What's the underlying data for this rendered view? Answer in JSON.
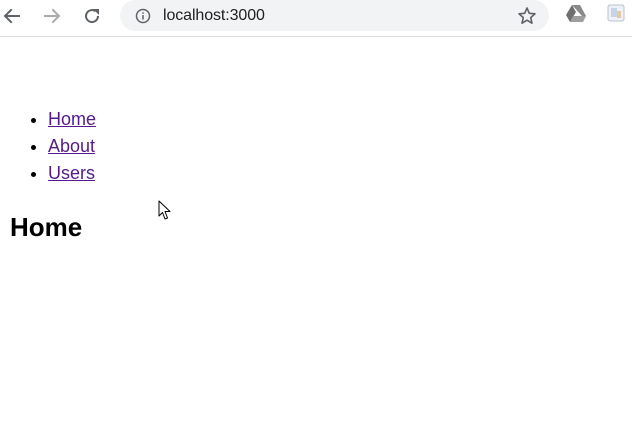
{
  "browser": {
    "url": "localhost:3000",
    "icons": {
      "back": "back-arrow-icon",
      "forward": "forward-arrow-icon",
      "reload": "reload-icon",
      "site_info": "info-icon",
      "bookmark": "star-icon",
      "extension_1": "google-drive-icon",
      "extension_2": "extension-icon"
    }
  },
  "page": {
    "nav": [
      {
        "label": "Home"
      },
      {
        "label": "About"
      },
      {
        "label": "Users"
      }
    ],
    "heading": "Home"
  },
  "colors": {
    "link_visited": "#551a8b",
    "omnibox_bg": "#f1f3f4",
    "toolbar_border": "#dadce0"
  }
}
